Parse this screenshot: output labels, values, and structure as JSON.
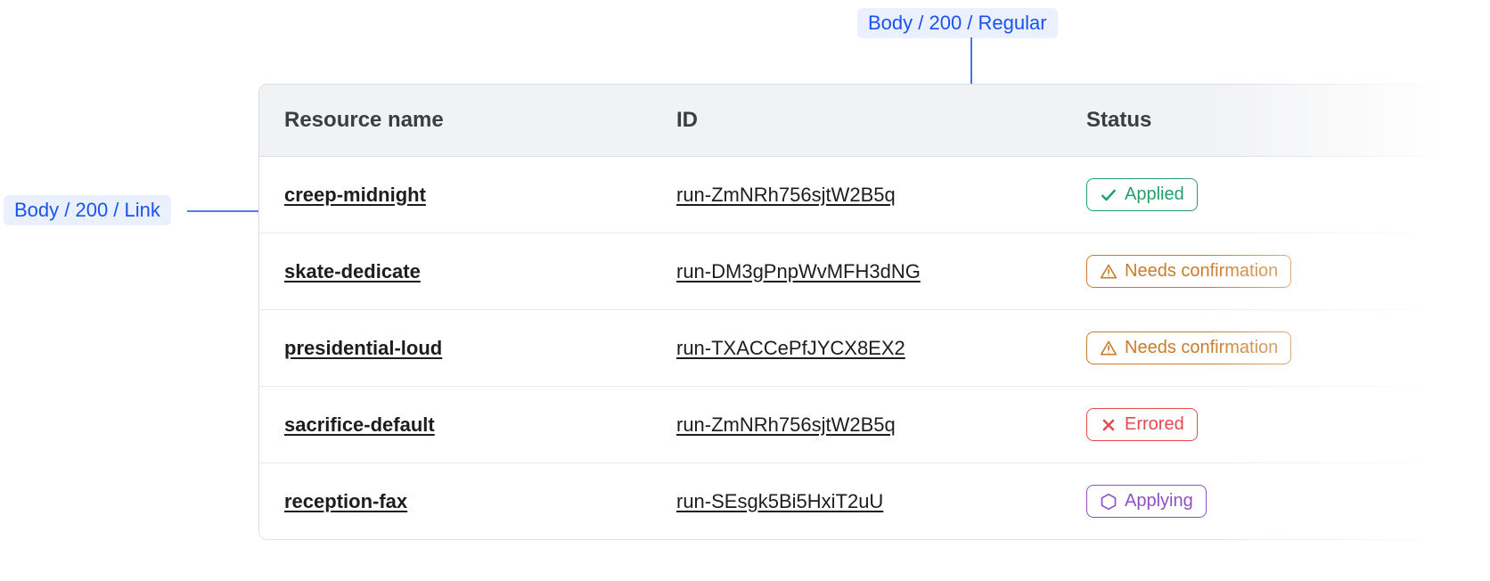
{
  "annotations": {
    "link": "Body / 200 / Link",
    "regular": "Body / 200 / Regular"
  },
  "table": {
    "headers": {
      "name": "Resource name",
      "id": "ID",
      "status": "Status"
    },
    "rows": [
      {
        "name": "creep-midnight",
        "id": "run-ZmNRh756sjtW2B5q",
        "status": {
          "kind": "applied",
          "label": "Applied"
        }
      },
      {
        "name": "skate-dedicate",
        "id": "run-DM3gPnpWvMFH3dNG",
        "status": {
          "kind": "needs",
          "label": "Needs confirmation"
        }
      },
      {
        "name": "presidential-loud",
        "id": "run-TXACCePfJYCX8EX2",
        "status": {
          "kind": "needs",
          "label": "Needs confirmation"
        }
      },
      {
        "name": "sacrifice-default",
        "id": "run-ZmNRh756sjtW2B5q",
        "status": {
          "kind": "errored",
          "label": "Errored"
        }
      },
      {
        "name": "reception-fax",
        "id": "run-SEsgk5Bi5HxiT2uU",
        "status": {
          "kind": "applying",
          "label": "Applying"
        }
      }
    ]
  },
  "colors": {
    "annotation_blue": "#1952ed",
    "applied": "#22a06b",
    "needs": "#c77d2b",
    "errored": "#e5484d",
    "applying": "#8e4ec6"
  }
}
